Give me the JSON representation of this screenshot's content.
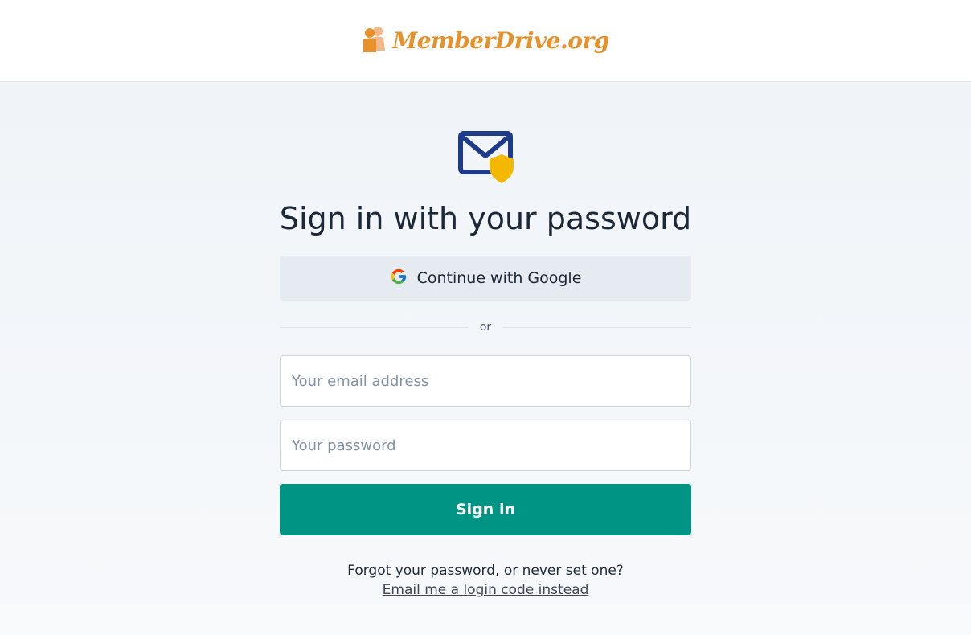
{
  "header": {
    "logo_text": "MemberDrive.org",
    "logo_icon": "people-icon"
  },
  "main": {
    "icon": "mail-shield-icon",
    "title": "Sign in with your password",
    "google_button_label": "Continue with Google",
    "divider_text": "or",
    "email_placeholder": "Your email address",
    "email_value": "",
    "password_placeholder": "Your password",
    "password_value": "",
    "signin_label": "Sign in",
    "forgot_text": "Forgot your password, or never set one?",
    "login_code_link": "Email me a login code instead"
  },
  "colors": {
    "brand_orange": "#e8912a",
    "primary_teal": "#009485",
    "mail_navy": "#1e3a8a",
    "shield_yellow": "#f5b800"
  }
}
